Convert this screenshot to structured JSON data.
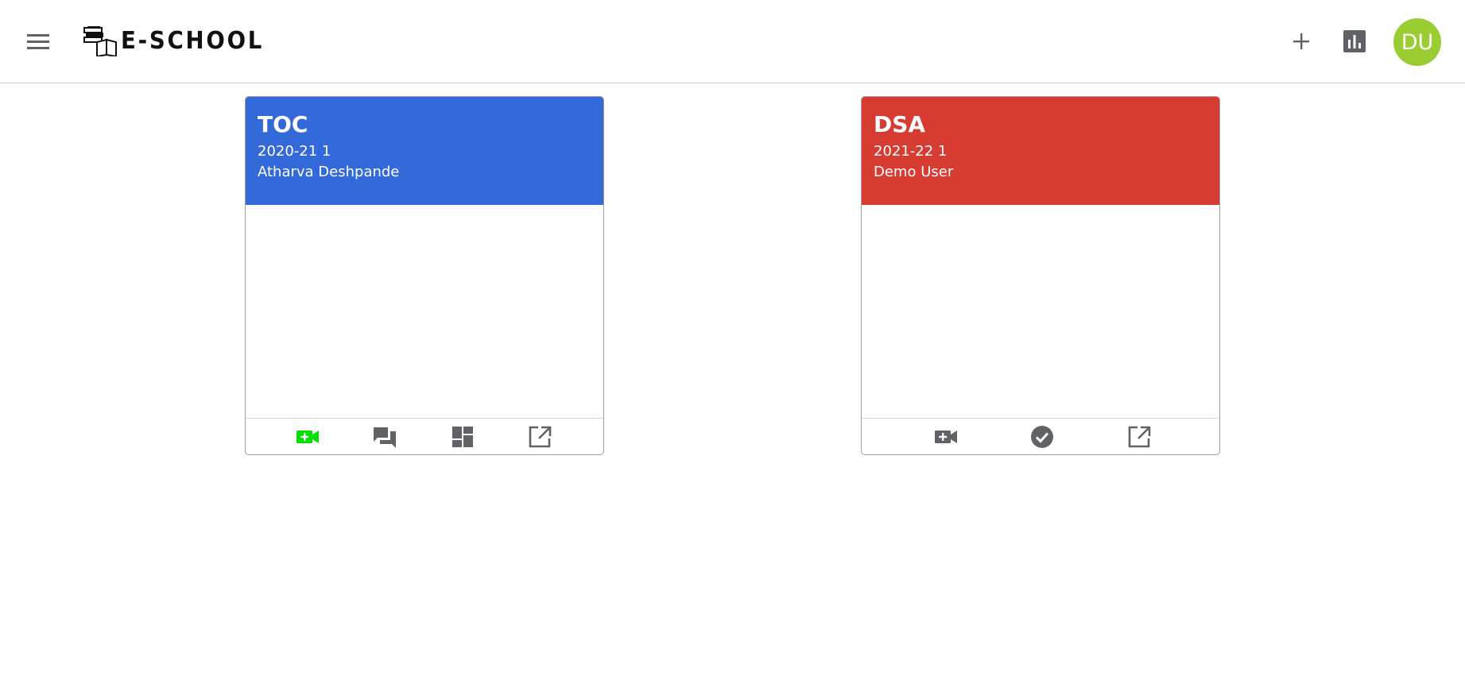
{
  "app": {
    "title": "E-SCHOOL"
  },
  "header": {
    "menu_icon": "hamburger-menu-icon",
    "add_icon": "plus-icon",
    "stats_icon": "bar-chart-icon",
    "avatar": {
      "initials": "DU",
      "color": "#9ACD32"
    }
  },
  "classes": [
    {
      "name": "TOC",
      "year": "2020-21 1",
      "teacher": "Atharva Deshpande",
      "color": "#3369D8",
      "actions": [
        "video-call-add-icon",
        "forum-icon",
        "dashboard-icon",
        "open-in-new-icon"
      ],
      "active_action_color": "#00E000"
    },
    {
      "name": "DSA",
      "year": "2021-22 1",
      "teacher": "Demo User",
      "color": "#D63C32",
      "actions": [
        "video-call-add-icon",
        "check-circle-icon",
        "open-in-new-icon"
      ]
    }
  ],
  "colors": {
    "icon_gray": "#5F6368"
  }
}
